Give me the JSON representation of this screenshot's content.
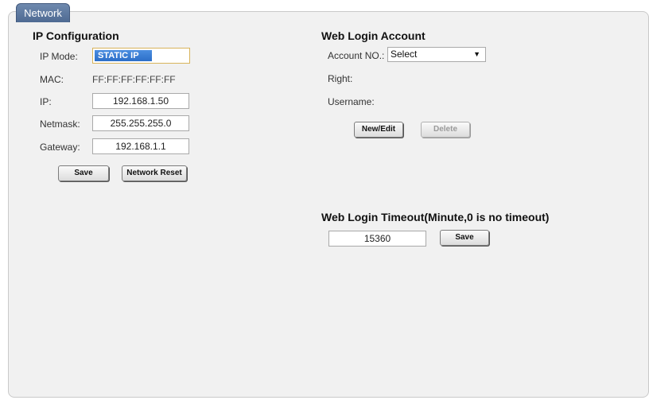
{
  "tab": {
    "label": "Network"
  },
  "ip_config": {
    "title": "IP Configuration",
    "mode_label": "IP Mode:",
    "mode_value": "STATIC IP",
    "mac_label": "MAC:",
    "mac_value": "FF:FF:FF:FF:FF:FF",
    "ip_label": "IP:",
    "ip_value": "192.168.1.50",
    "netmask_label": "Netmask:",
    "netmask_value": "255.255.255.0",
    "gateway_label": "Gateway:",
    "gateway_value": "192.168.1.1",
    "save_label": "Save",
    "reset_label": "Network Reset"
  },
  "web_login": {
    "title": "Web Login Account",
    "account_label": "Account NO.:",
    "account_value": "Select",
    "right_label": "Right:",
    "username_label": "Username:",
    "new_edit_label": "New/Edit",
    "delete_label": "Delete"
  },
  "timeout": {
    "title": "Web Login Timeout(Minute,0 is no timeout)",
    "value": "15360",
    "save_label": "Save"
  },
  "colors": {
    "tab": "#5a7498",
    "panel_bg": "#f1f1f1",
    "toggle_on": "#3a7fd8"
  }
}
